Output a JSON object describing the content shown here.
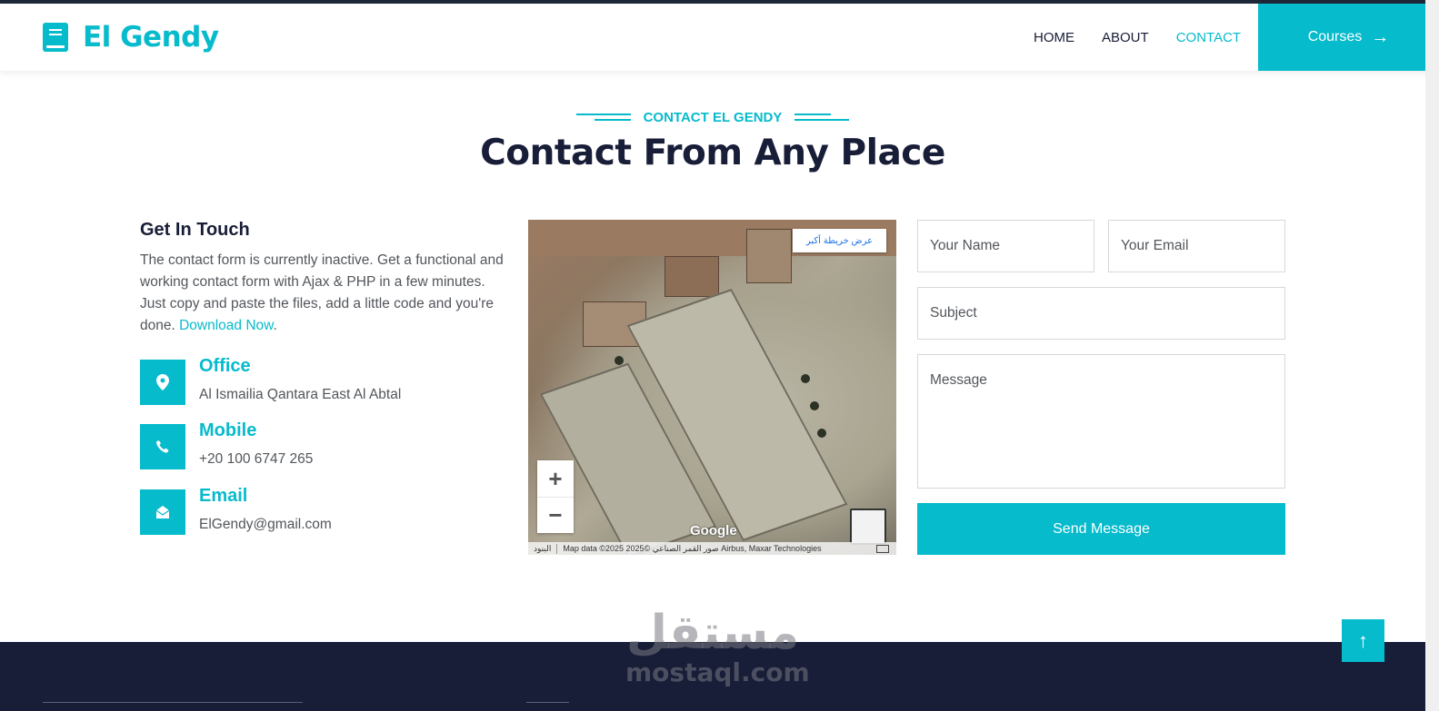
{
  "header": {
    "brand": "El Gendy",
    "nav": [
      {
        "label": "HOME",
        "active": false
      },
      {
        "label": "ABOUT",
        "active": false
      },
      {
        "label": "CONTACT",
        "active": true
      }
    ],
    "cta_label": "Courses",
    "cta_arrow": "→"
  },
  "section": {
    "subtitle": "CONTACT EL GENDY",
    "title": "Contact From Any Place"
  },
  "get_in_touch": {
    "title": "Get In Touch",
    "text": "The contact form is currently inactive. Get a functional and working contact form with Ajax & PHP in a few minutes. Just copy and paste the files, add a little code and you're done. ",
    "link_text": "Download Now",
    "text_end": "."
  },
  "info": [
    {
      "icon": "map-marker-icon",
      "glyph": "⬤",
      "title": "Office",
      "value": "Al Ismailia Qantara East Al Abtal"
    },
    {
      "icon": "phone-icon",
      "glyph": "✆",
      "title": "Mobile",
      "value": "+20 100 6747 265"
    },
    {
      "icon": "envelope-open-icon",
      "glyph": "✉",
      "title": "Email",
      "value": "ElGendy@gmail.com"
    }
  ],
  "map": {
    "view_larger": "عرض خريطة أكبر",
    "zoom_in": "+",
    "zoom_out": "−",
    "google": "Google",
    "terms": "البنود",
    "attribution": "Map data ©2025 صور القمر الصناعي ©2025 Airbus, Maxar Technologies"
  },
  "form": {
    "name_placeholder": "Your Name",
    "email_placeholder": "Your Email",
    "subject_placeholder": "Subject",
    "message_placeholder": "Message",
    "send_label": "Send Message"
  },
  "back_to_top": "↑",
  "watermark": {
    "arabic": "مستقل",
    "latin": "mostaql.com"
  },
  "colors": {
    "primary": "#06bbcc",
    "dark": "#181d38",
    "text": "#52565b"
  }
}
